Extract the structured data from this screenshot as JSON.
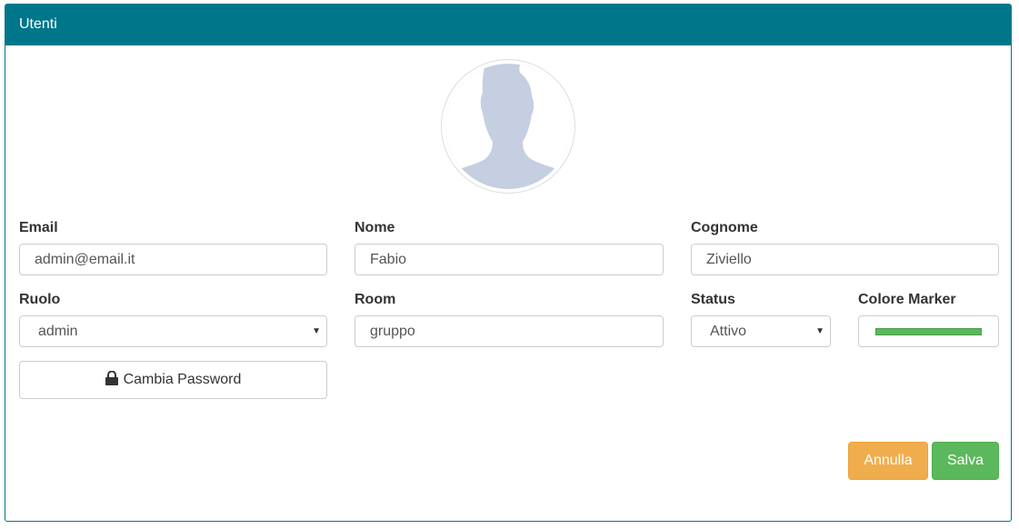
{
  "panel": {
    "title": "Utenti"
  },
  "avatar": {
    "icon": "user-silhouette-icon"
  },
  "form": {
    "email": {
      "label": "Email",
      "value": "admin@email.it"
    },
    "nome": {
      "label": "Nome",
      "value": "Fabio"
    },
    "cognome": {
      "label": "Cognome",
      "value": "Ziviello"
    },
    "ruolo": {
      "label": "Ruolo",
      "value": "admin"
    },
    "room": {
      "label": "Room",
      "value": "gruppo"
    },
    "status": {
      "label": "Status",
      "value": "Attivo"
    },
    "colore_marker": {
      "label": "Colore Marker",
      "value": "#5cb85c"
    }
  },
  "buttons": {
    "change_password": "Cambia Password",
    "cancel": "Annulla",
    "save": "Salva"
  },
  "colors": {
    "header": "#00768a",
    "cancel": "#f0ad4e",
    "save": "#5cb85c"
  }
}
